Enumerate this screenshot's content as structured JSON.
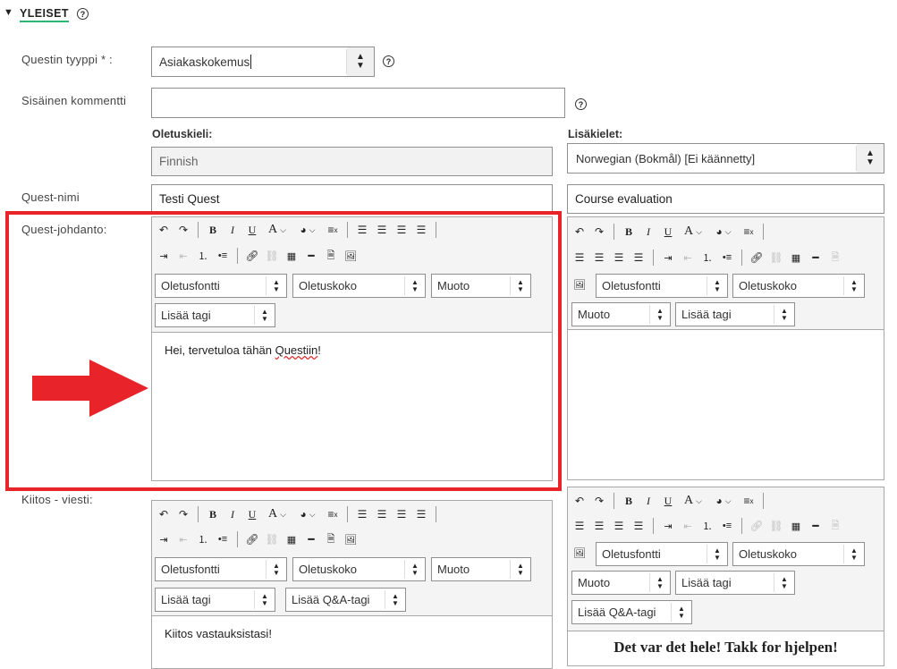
{
  "section": {
    "toggle": "▼",
    "title": "YLEISET",
    "help": "?"
  },
  "labels": {
    "type": "Questin tyyppi * :",
    "comment": "Sisäinen kommentti",
    "default_lang": "Oletuskieli:",
    "extra_langs": "Lisäkielet:",
    "name": "Quest-nimi",
    "intro": "Quest-johdanto:",
    "thanks": "Kiitos - viesti:"
  },
  "type_select": {
    "value": "Asiakaskokemus"
  },
  "comment_input": {
    "value": ""
  },
  "default_lang_value": "Finnish",
  "extra_lang_select": {
    "value": "Norwegian (Bokmål) [Ei käännetty]"
  },
  "name": {
    "default": "Testi Quest",
    "extra": "Course evaluation"
  },
  "editor": {
    "font": "Oletusfontti",
    "size": "Oletuskoko",
    "format": "Muoto",
    "tag": "Lisää tagi",
    "qa_tag": "Lisää Q&A-tagi"
  },
  "intro_text": {
    "default_pre": "Hei, tervetuloa tähän ",
    "default_word": "Questiin",
    "default_post": "!",
    "extra": ""
  },
  "thanks_text": {
    "default": "Kiitos vastauksistasi!",
    "extra": "Det var det hele! Takk for hjelpen!"
  },
  "icons": {
    "undo": "↶",
    "redo": "↷",
    "bold": "B",
    "italic": "I",
    "underline": "U",
    "font_color": "A",
    "bg_color": "palette-icon",
    "clear_format": "≡",
    "align_left": "≡",
    "align_center": "≡",
    "align_right": "≡",
    "justify": "≡",
    "dropdown": "⌵"
  },
  "colors": {
    "highlight": "#e8232a",
    "accent_green": "#2bb673"
  }
}
